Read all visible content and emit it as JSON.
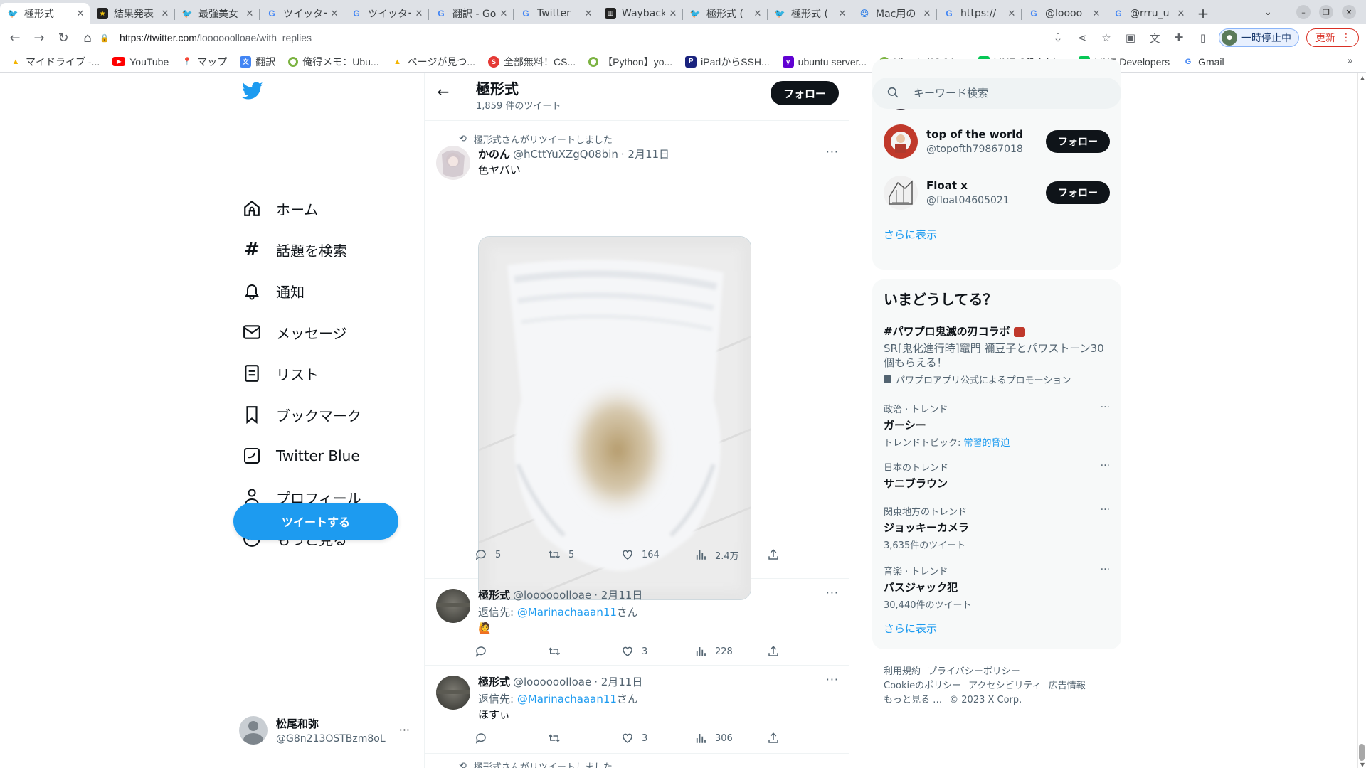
{
  "browser": {
    "tabs": [
      {
        "title": "極形式",
        "icon": "twitter-icon",
        "active": true
      },
      {
        "title": "結果発表",
        "icon": "black-favicon"
      },
      {
        "title": "最強美女",
        "icon": "twitter-icon"
      },
      {
        "title": "ツイッター",
        "icon": "google-icon"
      },
      {
        "title": "ツイッター",
        "icon": "google-icon"
      },
      {
        "title": "翻訳 - Go",
        "icon": "google-icon"
      },
      {
        "title": "Twitter",
        "icon": "google-icon"
      },
      {
        "title": "Wayback",
        "icon": "wayback-icon"
      },
      {
        "title": "極形式 (",
        "icon": "twitter-icon"
      },
      {
        "title": "極形式 (",
        "icon": "twitter-icon"
      },
      {
        "title": "Mac用の",
        "icon": "mac-icon"
      },
      {
        "title": "https://",
        "icon": "google-icon"
      },
      {
        "title": "@loooo",
        "icon": "google-icon"
      },
      {
        "title": "@rrru_u",
        "icon": "google-icon"
      }
    ],
    "url_host": "https://twitter.com",
    "url_path": "/loooooolloae/with_replies",
    "pause_label": "一時停止中",
    "update_label": "更新",
    "bookmarks": [
      {
        "label": "マイドライブ -...",
        "icon": "drive-icon",
        "color": "#f4b400"
      },
      {
        "label": "YouTube",
        "icon": "youtube-icon",
        "color": "#ff0000"
      },
      {
        "label": "マップ",
        "icon": "maps-icon",
        "color": "#34a853"
      },
      {
        "label": "翻訳",
        "icon": "translate-icon",
        "color": "#4285f4"
      },
      {
        "label": "俺得メモ：Ubu...",
        "icon": "green-circle-icon",
        "color": "#7cb342"
      },
      {
        "label": "ページが見つ...",
        "icon": "drive-icon",
        "color": "#f4b400"
      },
      {
        "label": "全部無料！CS...",
        "icon": "red-circle-icon",
        "color": "#e53935"
      },
      {
        "label": "【Python】yo...",
        "icon": "green-circle-icon",
        "color": "#7cb342"
      },
      {
        "label": "iPadからSSH...",
        "icon": "p-icon",
        "color": "#1a237e"
      },
      {
        "label": "ubuntu server...",
        "icon": "yahoo-icon",
        "color": "#6001d2"
      },
      {
        "label": "Ubuntu(18.04....",
        "icon": "green-circle-icon",
        "color": "#7cb342"
      },
      {
        "label": "LINE Official A...",
        "icon": "line-icon",
        "color": "#06c755"
      },
      {
        "label": "LINE Developers",
        "icon": "line-icon",
        "color": "#06c755"
      },
      {
        "label": "Gmail",
        "icon": "google-icon",
        "color": "#4285f4"
      }
    ]
  },
  "nav": {
    "items": [
      {
        "label": "ホーム",
        "icon": "home-icon"
      },
      {
        "label": "話題を検索",
        "icon": "hashtag-icon"
      },
      {
        "label": "通知",
        "icon": "bell-icon"
      },
      {
        "label": "メッセージ",
        "icon": "mail-icon"
      },
      {
        "label": "リスト",
        "icon": "list-icon"
      },
      {
        "label": "ブックマーク",
        "icon": "bookmark-icon"
      },
      {
        "label": "Twitter Blue",
        "icon": "twitter-blue-icon"
      },
      {
        "label": "プロフィール",
        "icon": "person-icon"
      },
      {
        "label": "もっと見る",
        "icon": "more-circle-icon"
      }
    ],
    "tweet_button": "ツイートする",
    "account_name": "松尾和弥",
    "account_handle": "@G8n213OSTBzm8oL"
  },
  "profile_header": {
    "name": "極形式",
    "tweet_count": "1,859 件のツイート",
    "follow_label": "フォロー"
  },
  "tweets": [
    {
      "retweeted_by": "極形式さんがリツイートしました",
      "name": "かのん",
      "handle": "@hCttYuXZgQ08bin",
      "date": "· 2月11日",
      "text": "色ヤバい",
      "replies": "5",
      "retweets": "5",
      "likes": "164",
      "views": "2.4万"
    },
    {
      "name": "極形式",
      "handle": "@loooooolloae",
      "date": "· 2月11日",
      "reply_prefix": "返信先: ",
      "reply_to": "@Marinachaaan11",
      "reply_suffix": "さん",
      "text": "🙋",
      "replies": "",
      "retweets": "",
      "likes": "3",
      "views": "228"
    },
    {
      "name": "極形式",
      "handle": "@loooooolloae",
      "date": "· 2月11日",
      "reply_prefix": "返信先: ",
      "reply_to": "@Marinachaaan11",
      "reply_suffix": "さん",
      "text": "ほすぃ",
      "replies": "",
      "retweets": "",
      "likes": "3",
      "views": "306"
    },
    {
      "retweeted_by": "極形式さんがリツイートしました"
    }
  ],
  "sidebar": {
    "search_placeholder": "キーワード検索",
    "who_to_follow": [
      {
        "name": "top of the world",
        "handle": "@topofth79867018",
        "follow": "フォロー"
      },
      {
        "name": "Float x",
        "handle": "@float04605021",
        "follow": "フォロー"
      }
    ],
    "show_more": "さらに表示",
    "trends_title": "いまどうしてる？",
    "promo": {
      "title": "#パワプロ鬼滅の刃コラボ",
      "desc": "SR[鬼化進行時]竈門 禰豆子とパワストーン30個もらえる！",
      "by": "パワプロアプリ公式によるプロモーション"
    },
    "trends": [
      {
        "context": "政治 · トレンド",
        "name": "ガーシー",
        "extra_prefix": "トレンドトピック: ",
        "extra_link": "常習的脅迫"
      },
      {
        "context": "日本のトレンド",
        "name": "サニブラウン"
      },
      {
        "context": "関東地方のトレンド",
        "name": "ジョッキーカメラ",
        "extra": "3,635件のツイート"
      },
      {
        "context": "音楽 · トレンド",
        "name": "バスジャック犯",
        "extra": "30,440件のツイート"
      }
    ],
    "footer": {
      "terms": "利用規約",
      "privacy": "プライバシーポリシー",
      "cookie": "Cookieのポリシー",
      "accessibility": "アクセシビリティ",
      "ads": "広告情報",
      "more": "もっと見る …",
      "copyright": "© 2023 X Corp."
    }
  },
  "colors": {
    "accent": "#1d9bf0",
    "text": "#0f1419",
    "muted": "#536471"
  }
}
